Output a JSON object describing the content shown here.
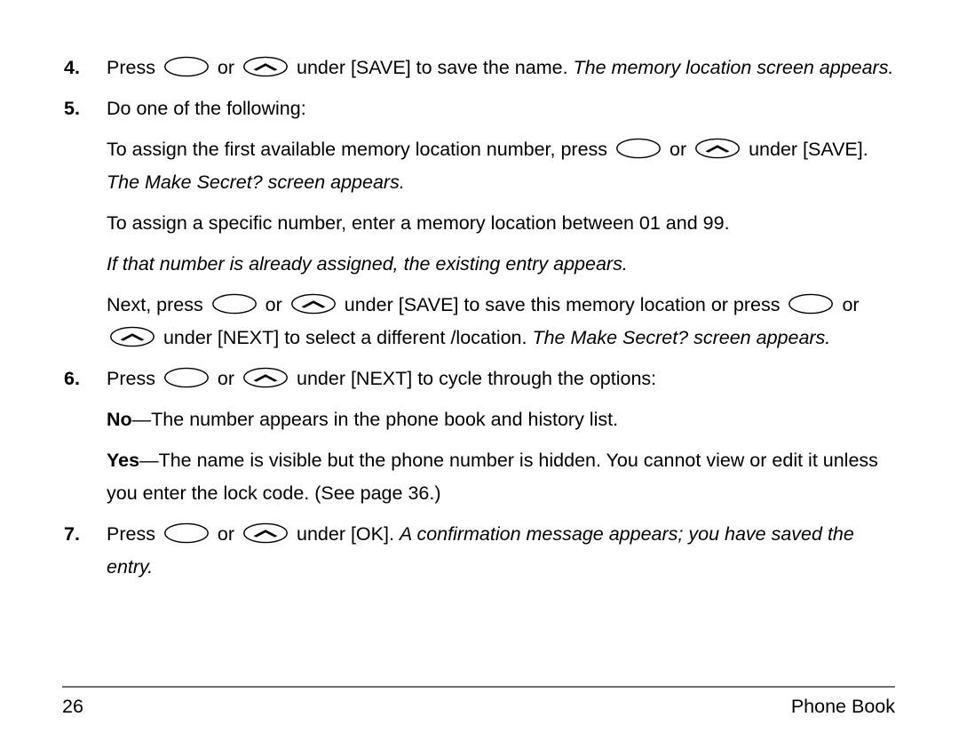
{
  "document": {
    "type": "user-manual-page",
    "page_number": "26",
    "footer_section": "Phone Book"
  },
  "icons": {
    "left_softkey": "oval-softkey-icon",
    "right_softkey": "oval-chevron-softkey-icon"
  },
  "steps": [
    {
      "number": "4.",
      "runs": [
        {
          "style": "regular",
          "text": "Press "
        },
        {
          "style": "icon",
          "text": "left_softkey"
        },
        {
          "style": "regular",
          "text": " or "
        },
        {
          "style": "icon",
          "text": "right_softkey"
        },
        {
          "style": "regular",
          "text": " under [SAVE] to save the name. "
        },
        {
          "style": "italic",
          "text": "The memory location screen appears."
        }
      ]
    },
    {
      "number": "5.",
      "runs": [
        {
          "style": "regular",
          "text": "Do one of the following:"
        }
      ]
    },
    {
      "number": "6.",
      "runs": [
        {
          "style": "regular",
          "text": "Press "
        },
        {
          "style": "icon",
          "text": "left_softkey"
        },
        {
          "style": "regular",
          "text": " or "
        },
        {
          "style": "icon",
          "text": "right_softkey"
        },
        {
          "style": "regular",
          "text": " under [NEXT] to cycle through the options:"
        }
      ]
    },
    {
      "number": "7.",
      "runs": [
        {
          "style": "regular",
          "text": "Press "
        },
        {
          "style": "icon",
          "text": "left_softkey"
        },
        {
          "style": "regular",
          "text": " or "
        },
        {
          "style": "icon",
          "text": "right_softkey"
        },
        {
          "style": "regular",
          "text": " under [OK]. "
        },
        {
          "style": "italic",
          "text": "A confirmation message appears; you have saved the entry."
        }
      ]
    }
  ],
  "paragraphs": {
    "p_first_available": [
      {
        "style": "regular",
        "text": "To assign the first available memory location number, press "
      },
      {
        "style": "icon",
        "text": "left_softkey"
      },
      {
        "style": "regular",
        "text": " or "
      },
      {
        "style": "icon",
        "text": "right_softkey"
      },
      {
        "style": "regular",
        "text": " under [SAVE]. "
      },
      {
        "style": "italic",
        "text": "The Make Secret? screen appears."
      }
    ],
    "p_specific_number": [
      {
        "style": "regular",
        "text": "To assign a specific number, enter a memory location between 01 and 99."
      }
    ],
    "p_already_assigned": [
      {
        "style": "italic",
        "text": "If that number is already assigned, the existing entry appears."
      }
    ],
    "p_next_press": [
      {
        "style": "regular",
        "text": "Next, press "
      },
      {
        "style": "icon",
        "text": "left_softkey"
      },
      {
        "style": "regular",
        "text": " or "
      },
      {
        "style": "icon",
        "text": "right_softkey"
      },
      {
        "style": "regular",
        "text": " under [SAVE] to save this memory location or press "
      },
      {
        "style": "icon",
        "text": "left_softkey"
      },
      {
        "style": "regular",
        "text": " or "
      },
      {
        "style": "icon",
        "text": "right_softkey"
      },
      {
        "style": "regular",
        "text": " under [NEXT] to select a different /location. "
      },
      {
        "style": "italic",
        "text": "The Make Secret? screen appears."
      }
    ],
    "p_option_no": [
      {
        "style": "bold",
        "text": "No"
      },
      {
        "style": "regular",
        "text": "—The number appears in the phone book and history list."
      }
    ],
    "p_option_yes": [
      {
        "style": "bold",
        "text": "Yes"
      },
      {
        "style": "regular",
        "text": "—The name is visible but the phone number is hidden. You cannot view or edit it unless you enter the lock code. (See page 36.)"
      }
    ]
  }
}
